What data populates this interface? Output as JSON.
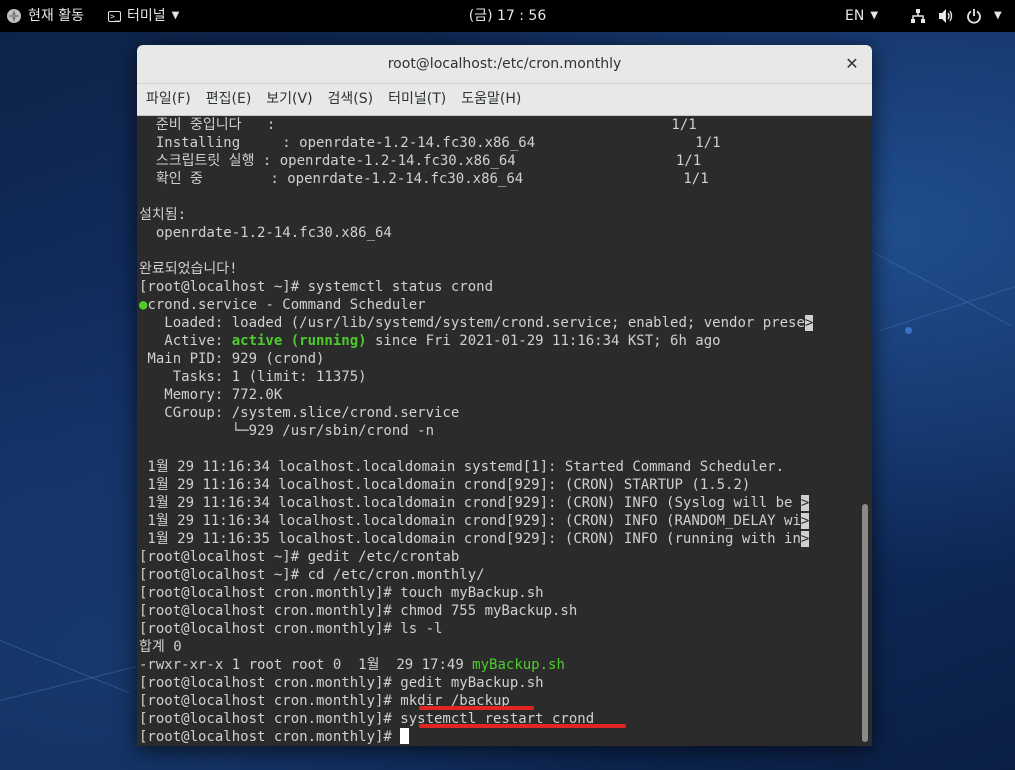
{
  "topbar": {
    "activities": "현재 활동",
    "app_name": "터미널",
    "clock": "(금) 17 : 56",
    "lang": "EN"
  },
  "window": {
    "title": "root@localhost:/etc/cron.monthly",
    "menu": [
      "파일(F)",
      "편집(E)",
      "보기(V)",
      "검색(S)",
      "터미널(T)",
      "도움말(H)"
    ]
  },
  "terminal": {
    "lines": [
      "  준비 중입니다   :                                               1/1",
      "  Installing     : openrdate-1.2-14.fc30.x86_64                   1/1",
      "  스크립트릿 실행 : openrdate-1.2-14.fc30.x86_64                   1/1",
      "  확인 중        : openrdate-1.2-14.fc30.x86_64                   1/1",
      "",
      "설치됨:",
      "  openrdate-1.2-14.fc30.x86_64",
      "",
      "완료되었습니다!",
      "[root@localhost ~]# systemctl status crond",
      "crond.service - Command Scheduler",
      "   Loaded: loaded (/usr/lib/systemd/system/crond.service; enabled; vendor prese",
      "   Active: ",
      " Main PID: 929 (crond)",
      "    Tasks: 1 (limit: 11375)",
      "   Memory: 772.0K",
      "   CGroup: /system.slice/crond.service",
      "           └─929 /usr/sbin/crond -n",
      "",
      " 1월 29 11:16:34 localhost.localdomain systemd[1]: Started Command Scheduler.",
      " 1월 29 11:16:34 localhost.localdomain crond[929]: (CRON) STARTUP (1.5.2)",
      " 1월 29 11:16:34 localhost.localdomain crond[929]: (CRON) INFO (Syslog will be ",
      " 1월 29 11:16:34 localhost.localdomain crond[929]: (CRON) INFO (RANDOM_DELAY wi",
      " 1월 29 11:16:35 localhost.localdomain crond[929]: (CRON) INFO (running with in",
      "[root@localhost ~]# gedit /etc/crontab",
      "[root@localhost ~]# cd /etc/cron.monthly/",
      "[root@localhost cron.monthly]# touch myBackup.sh",
      "[root@localhost cron.monthly]# chmod 755 myBackup.sh",
      "[root@localhost cron.monthly]# ls -l",
      "합계 0",
      "-rwxr-xr-x 1 root root 0  1월  29 17:49 ",
      "[root@localhost cron.monthly]# gedit myBackup.sh",
      "[root@localhost cron.monthly]# mkdir /backup",
      "[root@localhost cron.monthly]# systemctl restart crond",
      "[root@localhost cron.monthly]# "
    ],
    "active_status": "active (running)",
    "active_rest": " since Fri 2021-01-29 11:16:34 KST; 6h ago",
    "ls_file": "myBackup.sh",
    "status_dot": "●",
    "overflow_marker": ">",
    "colors": {
      "green": "#4ecc2c",
      "underline": "#e12525"
    }
  }
}
